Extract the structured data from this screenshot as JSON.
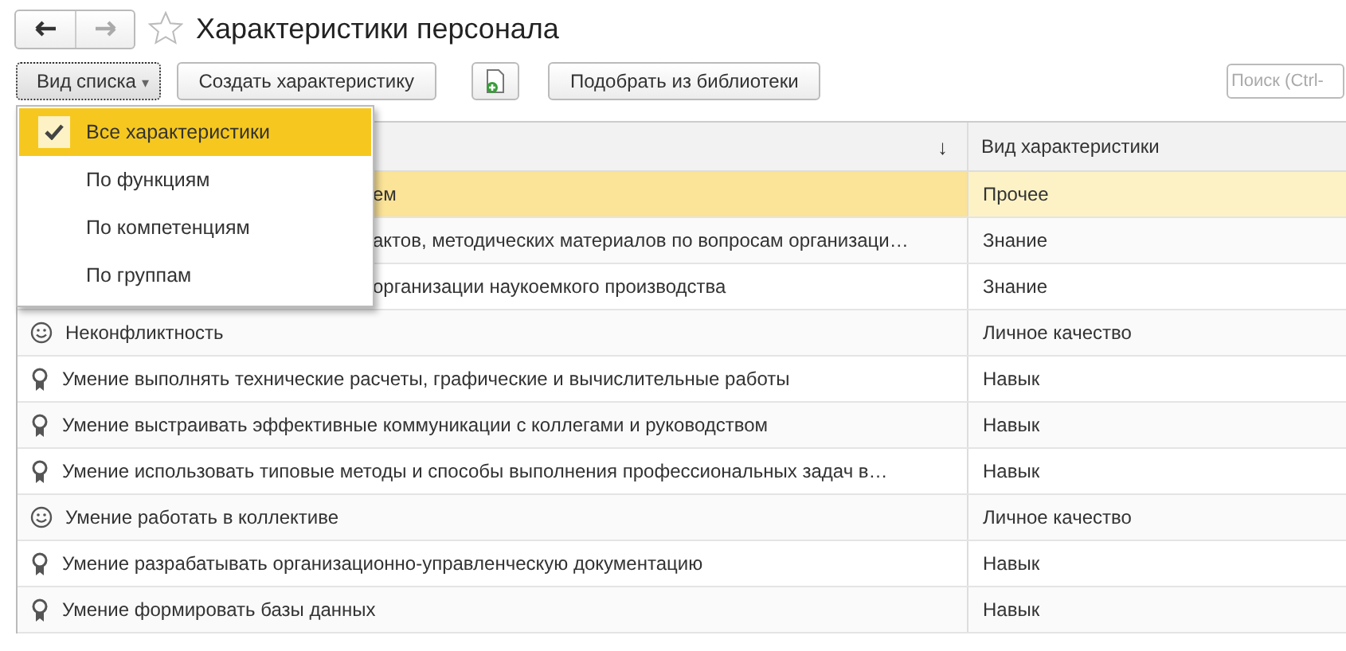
{
  "window": {
    "title": "Характеристики персонала",
    "favorite": false
  },
  "toolbar": {
    "list_view_button": "Вид списка",
    "list_view_caret": "▾",
    "create_button": "Создать характеристику",
    "pick_button": "Подобрать из библиотеки",
    "search": {
      "placeholder": "Поиск (Ctrl-"
    }
  },
  "list_view_menu": [
    {
      "label": "Все характеристики",
      "selected": true
    },
    {
      "label": "По функциям",
      "selected": false
    },
    {
      "label": "По компетенциям",
      "selected": false
    },
    {
      "label": "По группам",
      "selected": false
    }
  ],
  "table": {
    "columns": [
      {
        "sort_mark": "↓"
      },
      {
        "label": "Вид характеристики"
      }
    ],
    "rows": [
      {
        "name": "ем",
        "type": "Прочее",
        "selected": true
      },
      {
        "name": "актов, методических материалов по вопросам организаци…",
        "type": "Знание",
        "selected": false
      },
      {
        "name": "организации наукоемкого производства",
        "type": "Знание",
        "selected": false
      },
      {
        "kind": "quality",
        "name": "Неконфликтность",
        "type": "Личное качество",
        "selected": false
      },
      {
        "kind": "skill",
        "name": "Умение выполнять технические расчеты, графические и вычислительные работы",
        "type": "Навык",
        "selected": false
      },
      {
        "kind": "skill",
        "name": "Умение выстраивать эффективные коммуникации с коллегами и руководством",
        "type": "Навык",
        "selected": false
      },
      {
        "kind": "skill",
        "name": "Умение использовать типовые методы и способы выполнения профессиональных задач в…",
        "type": "Навык",
        "selected": false
      },
      {
        "kind": "quality",
        "name": "Умение работать в коллективе",
        "type": "Личное качество",
        "selected": false
      },
      {
        "kind": "skill",
        "name": "Умение разрабатывать организационно-управленческую документацию",
        "type": "Навык",
        "selected": false
      },
      {
        "kind": "skill",
        "name": "Умение формировать базы данных",
        "type": "Навык",
        "selected": false
      }
    ]
  }
}
